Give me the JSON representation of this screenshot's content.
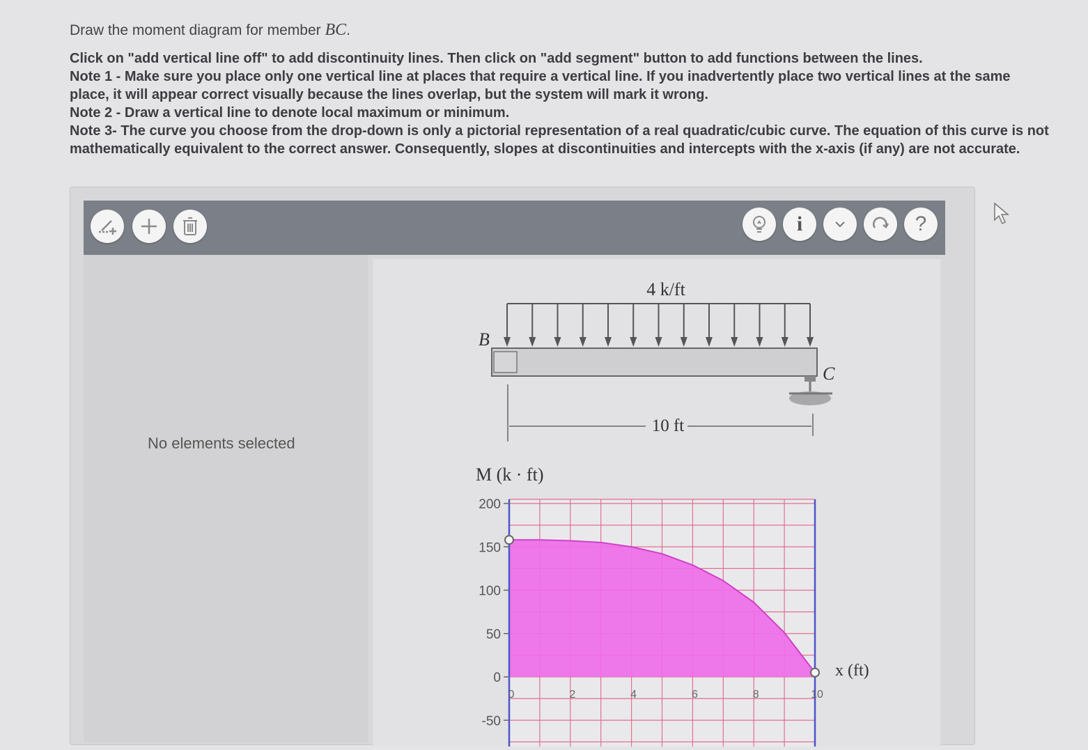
{
  "question": {
    "prefix": "Draw the moment diagram for member ",
    "member": "BC",
    "suffix": "."
  },
  "notes": [
    "Click on \"add vertical line off\" to add discontinuity lines. Then click on \"add segment\" button to add functions between the lines.",
    "Note 1 - Make sure you place only one vertical line at places that require a vertical line. If you inadvertently place two vertical lines at the same place, it will appear correct visually because the lines overlap, but the system will mark it wrong.",
    "Note 2 - Draw a vertical line to denote local maximum or minimum.",
    "Note 3- The curve you choose from the drop-down is only a pictorial representation of a real quadratic/cubic curve. The equation of this curve is not mathematically equivalent to the correct answer. Consequently, slopes at discontinuities and intercepts with the x-axis (if any) are not accurate."
  ],
  "toolbar": {
    "left_icons": [
      "add-vertical-line-icon",
      "plus-icon",
      "trash-icon"
    ],
    "right_icons": [
      "lightbulb-icon",
      "info-icon",
      "chevron-down-icon",
      "redo-icon",
      "help-icon"
    ],
    "info_glyph": "i",
    "help_glyph": "?"
  },
  "side_panel": {
    "empty_text": "No elements selected"
  },
  "beam": {
    "load_label": "4 k/ft",
    "left_label": "B",
    "right_label": "C",
    "span_label": "10 ft"
  },
  "colors": {
    "toolbar": "#7b7f87",
    "fill": "#ee6ee8",
    "grid": "#e07090",
    "axis": "#4a55cc"
  },
  "chart_data": {
    "type": "area",
    "ylabel": "M (k · ft)",
    "xlabel": "x (ft)",
    "xlim": [
      0,
      10
    ],
    "ylim": [
      -50,
      200
    ],
    "x_ticks": [
      "0",
      "2",
      "4",
      "6",
      "8",
      "10"
    ],
    "y_ticks": [
      "200",
      "150",
      "100",
      "50",
      "0",
      "-50"
    ],
    "series": [
      {
        "x": [
          0,
          1,
          2,
          3,
          4,
          5,
          6,
          7,
          8,
          9,
          10
        ],
        "y": [
          158,
          158,
          157,
          155,
          150,
          142,
          129,
          111,
          86,
          51,
          5
        ]
      }
    ],
    "endpoints": [
      [
        0,
        158
      ],
      [
        10,
        5
      ]
    ],
    "grid": true
  }
}
